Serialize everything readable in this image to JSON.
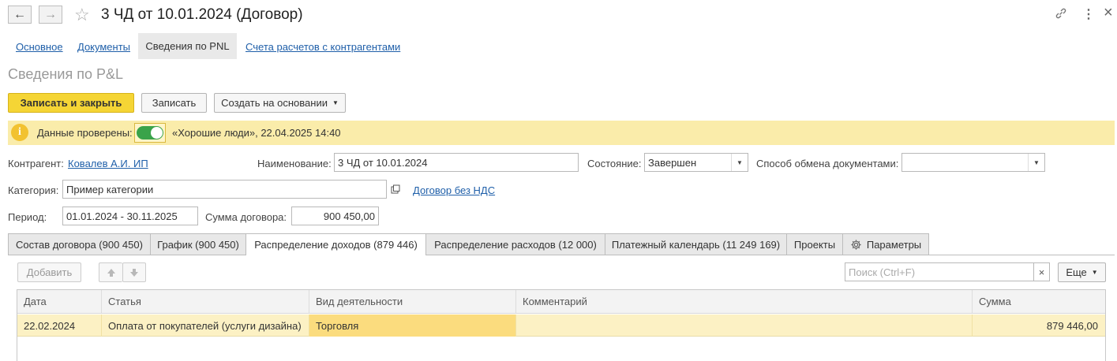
{
  "window": {
    "title": "3 ЧД от 10.01.2024 (Договор)",
    "back_icon": "←",
    "forward_icon": "→",
    "star_icon": "☆",
    "link_icon": "🔗",
    "more_icon": "⋮",
    "close_icon": "×"
  },
  "nav_tabs": [
    {
      "label": "Основное"
    },
    {
      "label": "Документы"
    },
    {
      "label": "Сведения по PNL"
    },
    {
      "label": "Счета расчетов с контрагентами"
    }
  ],
  "section_title": "Сведения по P&L",
  "toolbar": {
    "save_close": "Записать и закрыть",
    "save": "Записать",
    "create_based": "Создать на основании"
  },
  "banner": {
    "info_icon": "i",
    "label": "Данные проверены:",
    "toggle_on": true,
    "text": "«Хорошие люди», 22.04.2025 14:40"
  },
  "form": {
    "counterparty_label": "Контрагент:",
    "counterparty_value": "Ковалев А.И. ИП",
    "name_label": "Наименование:",
    "name_value": "3 ЧД от 10.01.2024",
    "state_label": "Состояние:",
    "state_value": "Завершен",
    "exchange_label": "Способ обмена документами:",
    "exchange_value": "",
    "category_label": "Категория:",
    "category_value": "Пример категории",
    "vat_link": "Договор без НДС",
    "period_label": "Период:",
    "period_value": "01.01.2024 - 30.11.2025",
    "sum_label": "Сумма договора:",
    "sum_value": "900 450,00"
  },
  "tabs": [
    {
      "label": "Состав договора (900 450)"
    },
    {
      "label": "График (900 450)"
    },
    {
      "label": "Распределение доходов (879 446)"
    },
    {
      "label": "Распределение расходов (12 000)"
    },
    {
      "label": "Платежный календарь (11 249 169)"
    },
    {
      "label": "Проекты"
    },
    {
      "label": "Параметры"
    }
  ],
  "table_toolbar": {
    "add": "Добавить",
    "up_icon": "🡅",
    "down_icon": "🡇",
    "search_placeholder": "Поиск (Ctrl+F)",
    "clear": "×",
    "more": "Еще"
  },
  "table": {
    "columns": [
      "Дата",
      "Статья",
      "Вид деятельности",
      "Комментарий",
      "Сумма"
    ],
    "rows": [
      [
        "22.02.2024",
        "Оплата от покупателей (услуги дизайна)",
        "Торговля",
        "",
        "879 446,00"
      ]
    ]
  },
  "colors": {
    "accent_yellow": "#f5d535",
    "banner_bg": "#faecaa",
    "toggle_green": "#3aa34a",
    "link_blue": "#1f5fa9"
  }
}
